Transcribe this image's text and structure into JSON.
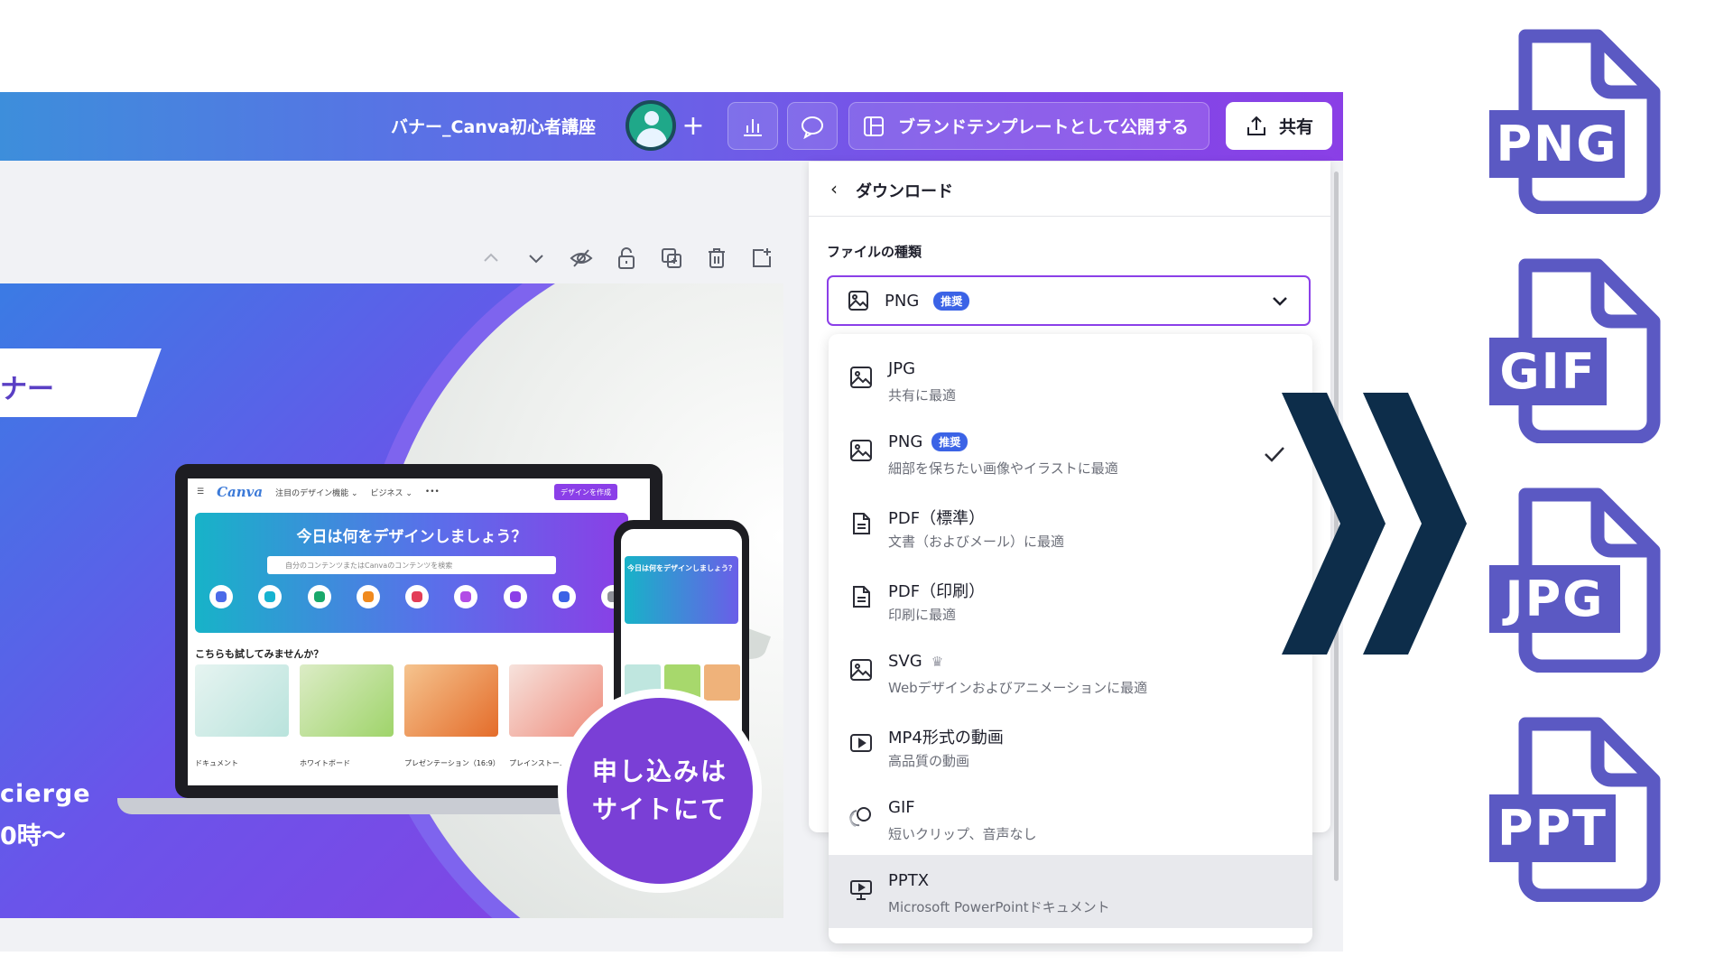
{
  "topbar": {
    "doc_title": "バナー_Canva初心者講座",
    "brand_template": "ブランドテンプレートとして公開する",
    "share": "共有"
  },
  "canvas": {
    "banner_text": "ナー",
    "line1": "cierge",
    "line2": "0時〜",
    "badge_line1": "申し込みは",
    "badge_line2": "サイトにて",
    "laptop": {
      "logo": "Canva",
      "nav1": "注目のデザイン機能 ⌄",
      "nav2": "ビジネス ⌄",
      "nav3": "•••",
      "cta": "デザインを作成",
      "hero_title": "今日は何をデザインしましょう？",
      "search_placeholder": "自分のコンテンツまたはCanvaのコンテンツを検索",
      "section": "こちらも試してみませんか？",
      "card_labels": [
        "ドキュメント",
        "ホワイトボード",
        "プレゼンテーション（16:9）",
        "プレインストー..."
      ]
    },
    "phone": {
      "hero_title": "今日は何をデザインしましょう？"
    }
  },
  "download": {
    "title": "ダウンロード",
    "file_type_label": "ファイルの種類",
    "selected": "PNG",
    "selected_tag": "推奨",
    "options": [
      {
        "name": "JPG",
        "desc": "共有に最適"
      },
      {
        "name": "PNG",
        "tag": "推奨",
        "desc": "細部を保ちたい画像やイラストに最適"
      },
      {
        "name": "PDF（標準）",
        "desc": "文書（およびメール）に最適"
      },
      {
        "name": "PDF（印刷）",
        "desc": "印刷に最適"
      },
      {
        "name": "SVG",
        "crown": "♛",
        "desc": "Webデザインおよびアニメーションに最適"
      },
      {
        "name": "MP4形式の動画",
        "desc": "高品質の動画"
      },
      {
        "name": "GIF",
        "desc": "短いクリップ、音声なし"
      },
      {
        "name": "PPTX",
        "desc": "Microsoft PowerPointドキュメント"
      }
    ]
  },
  "file_icons": [
    "PNG",
    "GIF",
    "JPG",
    "PPT"
  ],
  "colors": {
    "accent_purple": "#8b3fe8",
    "tag_blue": "#3b63e6",
    "chevron_navy": "#0d2d4a",
    "file_icon_purple": "#5b59c3"
  }
}
